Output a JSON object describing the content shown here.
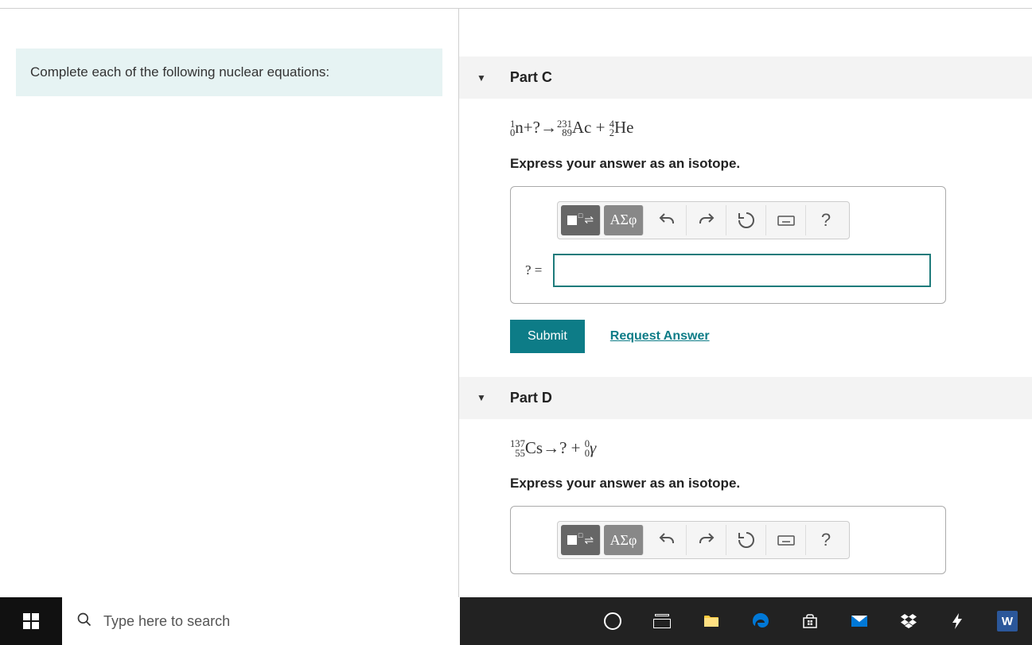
{
  "left": {
    "instruction": "Complete each of the following nuclear equations:"
  },
  "partC": {
    "title": "Part C",
    "instruction": "Express your answer as an isotope.",
    "label": "? =",
    "submit": "Submit",
    "request": "Request Answer",
    "greek": "ΑΣφ",
    "help": "?",
    "equation": {
      "n_top": "1",
      "n_bot": "0",
      "n_sym": "n",
      "plus1": "+?→",
      "ac_top": "231",
      "ac_bot": "89",
      "ac_sym": "Ac",
      "plus2": " + ",
      "he_top": "4",
      "he_bot": "2",
      "he_sym": "He"
    }
  },
  "partD": {
    "title": "Part D",
    "instruction": "Express your answer as an isotope.",
    "greek": "ΑΣφ",
    "help": "?",
    "equation": {
      "cs_top": "137",
      "cs_bot": "55",
      "cs_sym": "Cs",
      "arrow": "→? + ",
      "g_top": "0",
      "g_bot": "0",
      "g_sym": "γ"
    }
  },
  "taskbar": {
    "search_placeholder": "Type here to search",
    "word": "W"
  }
}
